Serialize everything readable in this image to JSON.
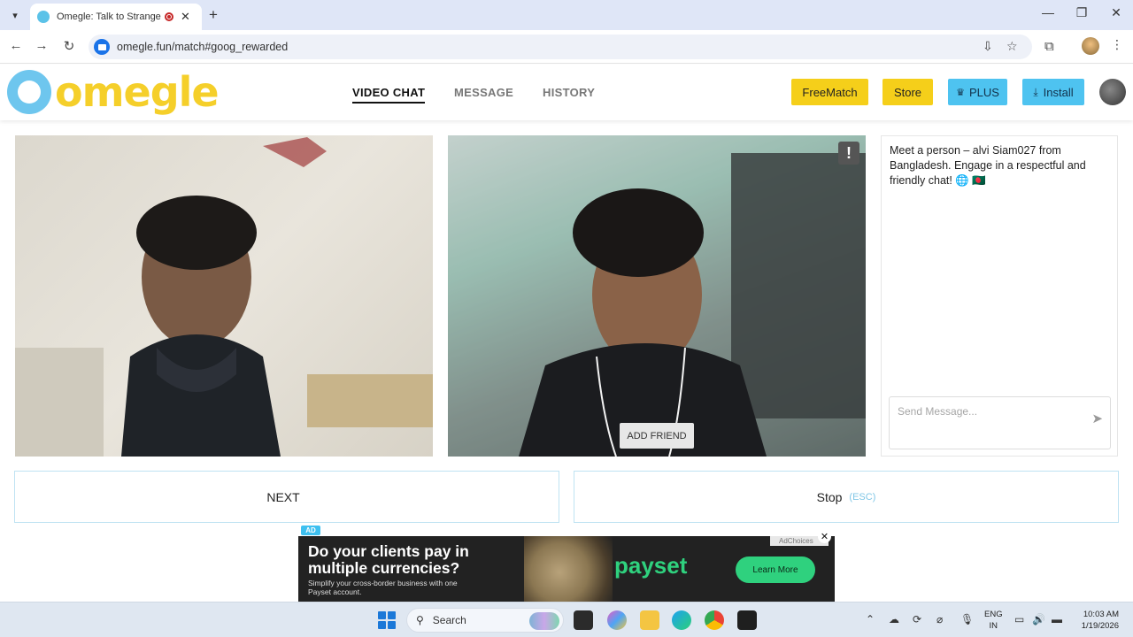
{
  "browser": {
    "tab_title": "Omegle: Talk to Strangers w",
    "tab_close": "✕",
    "new_tab": "+",
    "url": "omegle.fun/match#goog_rewarded",
    "window_controls": {
      "minimize": "—",
      "maximize": "❐",
      "close": "✕"
    },
    "nav": {
      "back": "←",
      "forward": "→",
      "reload": "↻"
    },
    "menu": "⋮"
  },
  "site": {
    "logo_text": "omegle",
    "nav": [
      {
        "label": "VIDEO CHAT",
        "active": true
      },
      {
        "label": "MESSAGE",
        "active": false
      },
      {
        "label": "HISTORY",
        "active": false
      }
    ],
    "buttons": {
      "freematch": "FreeMatch",
      "store": "Store",
      "plus": "PLUS",
      "install": "Install"
    }
  },
  "video": {
    "report_icon": "!",
    "add_friend": "ADD FRIEND"
  },
  "chat": {
    "intro": "Meet a person – alvi Siam027 from Bangladesh. Engage in a respectful and friendly chat! 🌐 🇧🇩",
    "placeholder": "Send Message...",
    "send_icon": "➤"
  },
  "actions": {
    "next_label": "NEXT",
    "next_hint": "",
    "stop_label": "Stop",
    "stop_hint": "(ESC)"
  },
  "ad": {
    "tag": "AD",
    "headline": "Do your clients pay in multiple currencies?",
    "sub": "Simplify your cross-border business with one Payset account.",
    "brand": "payset",
    "cta": "Learn More",
    "close": "✕",
    "choice": "AdChoices"
  },
  "taskbar": {
    "search_label": "Search",
    "lang": "ENG",
    "region": "IN",
    "time": "10:03 AM",
    "date": "1/19/2026"
  },
  "colors": {
    "brand_yellow": "#f5cf1a",
    "brand_blue": "#4ec3f0",
    "hint_blue": "#7fc6e6",
    "ad_green": "#2fd17e"
  }
}
